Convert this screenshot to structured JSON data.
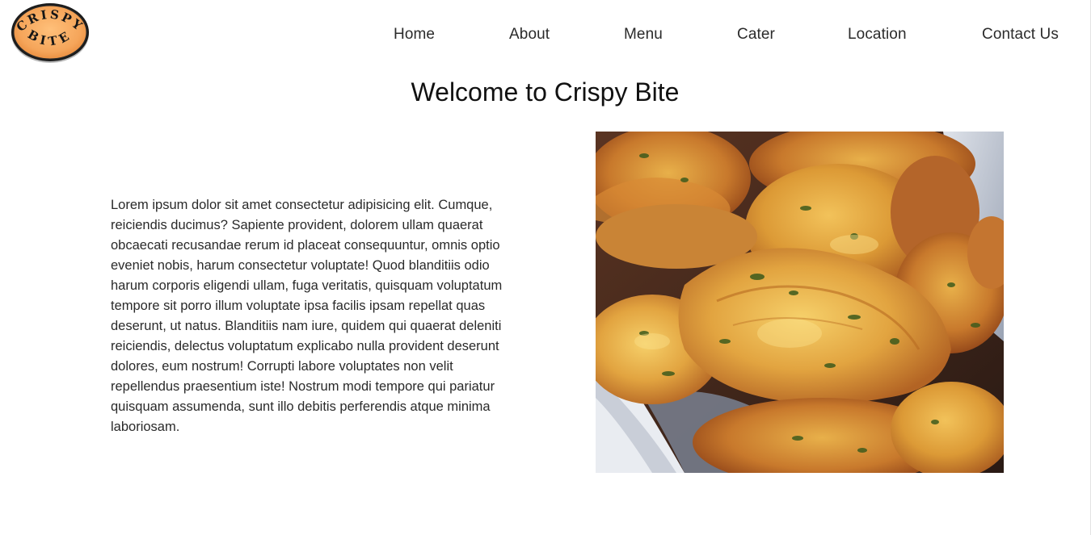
{
  "brand": {
    "logo_line1": "CRISPY",
    "logo_line2": "BITE",
    "colors": {
      "logo_fill": "#f5a55a",
      "logo_ring": "#1c1c1c",
      "logo_text": "#161616"
    }
  },
  "nav": {
    "items": [
      {
        "label": "Home"
      },
      {
        "label": "About"
      },
      {
        "label": "Menu"
      },
      {
        "label": "Cater"
      },
      {
        "label": "Location"
      },
      {
        "label": "Contact Us"
      }
    ]
  },
  "main": {
    "heading": "Welcome to Crispy Bite",
    "body": "Lorem ipsum dolor sit amet consectetur adipisicing elit. Cumque, reiciendis ducimus? Sapiente provident, dolorem ullam quaerat obcaecati recusandae rerum id placeat consequuntur, omnis optio eveniet nobis, harum consectetur voluptate! Quod blanditiis odio harum corporis eligendi ullam, fuga veritatis, quisquam voluptatum tempore sit porro illum voluptate ipsa facilis ipsam repellat quas deserunt, ut natus. Blanditiis nam iure, quidem qui quaerat deleniti reiciendis, delectus voluptatum explicabo nulla provident deserunt dolores, eum nostrum! Corrupti labore voluptates non velit repellendus praesentium iste! Nostrum modi tempore qui pariatur quisquam assumenda, sunt illo debitis perferendis atque minima laboriosam.",
    "image_subject": "fried-pakora-fritters-photo"
  }
}
